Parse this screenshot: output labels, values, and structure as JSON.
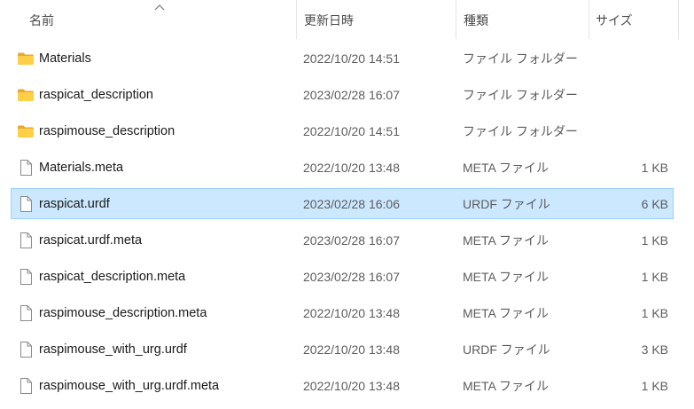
{
  "columns": {
    "name": "名前",
    "date": "更新日時",
    "type": "種類",
    "size": "サイズ"
  },
  "sort_indicator": "chevron-up-icon",
  "colors": {
    "selection_bg": "#cce8ff",
    "selection_border": "#99d1ff",
    "folder_yellow": "#ffcf48"
  },
  "files": [
    {
      "name": "Materials",
      "date": "2022/10/20 14:51",
      "type": "ファイル フォルダー",
      "size": "",
      "icon": "folder-icon",
      "selected": false
    },
    {
      "name": "raspicat_description",
      "date": "2023/02/28 16:07",
      "type": "ファイル フォルダー",
      "size": "",
      "icon": "folder-icon",
      "selected": false
    },
    {
      "name": "raspimouse_description",
      "date": "2022/10/20 14:51",
      "type": "ファイル フォルダー",
      "size": "",
      "icon": "folder-icon",
      "selected": false
    },
    {
      "name": "Materials.meta",
      "date": "2022/10/20 13:48",
      "type": "META ファイル",
      "size": "1 KB",
      "icon": "file-icon",
      "selected": false
    },
    {
      "name": "raspicat.urdf",
      "date": "2023/02/28 16:06",
      "type": "URDF ファイル",
      "size": "6 KB",
      "icon": "file-icon",
      "selected": true
    },
    {
      "name": "raspicat.urdf.meta",
      "date": "2023/02/28 16:07",
      "type": "META ファイル",
      "size": "1 KB",
      "icon": "file-icon",
      "selected": false
    },
    {
      "name": "raspicat_description.meta",
      "date": "2023/02/28 16:07",
      "type": "META ファイル",
      "size": "1 KB",
      "icon": "file-icon",
      "selected": false
    },
    {
      "name": "raspimouse_description.meta",
      "date": "2022/10/20 13:48",
      "type": "META ファイル",
      "size": "1 KB",
      "icon": "file-icon",
      "selected": false
    },
    {
      "name": "raspimouse_with_urg.urdf",
      "date": "2022/10/20 13:48",
      "type": "URDF ファイル",
      "size": "3 KB",
      "icon": "file-icon",
      "selected": false
    },
    {
      "name": "raspimouse_with_urg.urdf.meta",
      "date": "2022/10/20 13:48",
      "type": "META ファイル",
      "size": "1 KB",
      "icon": "file-icon",
      "selected": false
    }
  ]
}
